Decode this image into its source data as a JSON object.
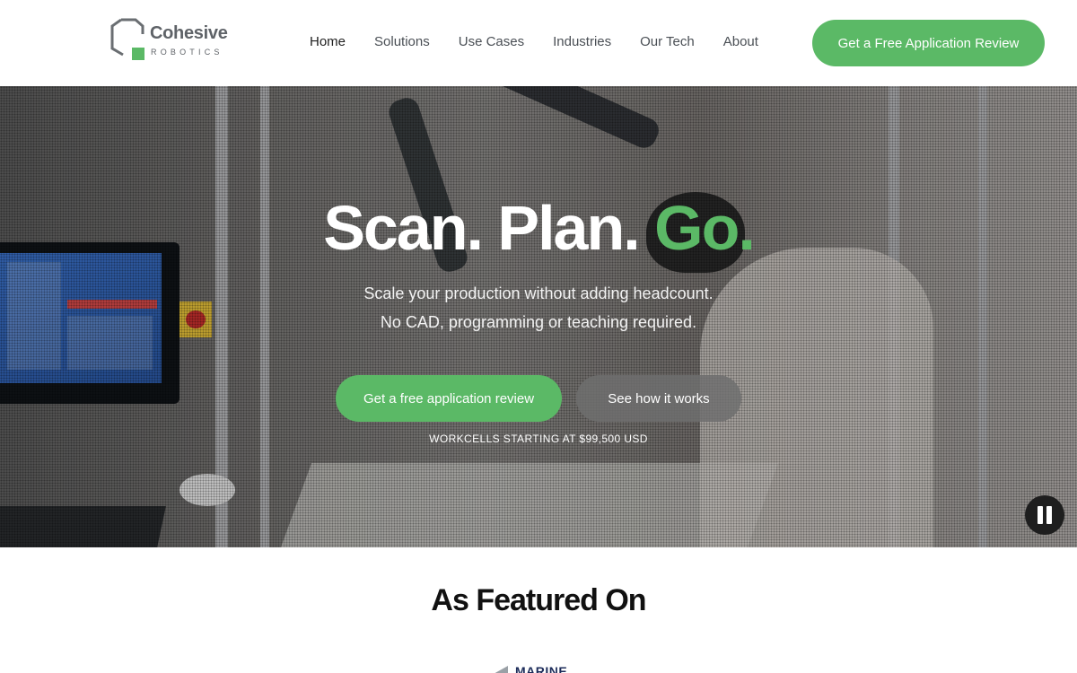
{
  "brand": {
    "name": "Cohesive",
    "tagline": "ROBOTICS",
    "colors": {
      "accent": "#5bb966",
      "logo_gray": "#5f6368"
    }
  },
  "nav": {
    "items": [
      {
        "label": "Home",
        "active": true
      },
      {
        "label": "Solutions"
      },
      {
        "label": "Use Cases"
      },
      {
        "label": "Industries"
      },
      {
        "label": "Our Tech"
      },
      {
        "label": "About"
      }
    ],
    "cta_label": "Get a Free Application Review"
  },
  "hero": {
    "title_part1": "Scan. Plan. ",
    "title_part2": "Go",
    "title_part3": ".",
    "subtitle_line1": "Scale your production without adding headcount.",
    "subtitle_line2": "No CAD, programming or teaching required.",
    "primary_button": "Get a free application review",
    "secondary_button": "See how it works",
    "price_note": "WORKCELLS STARTING AT $99,500 USD",
    "video_control": "pause-icon"
  },
  "featured": {
    "title": "As Featured On",
    "logos": [
      {
        "text": ""
      },
      {
        "text": "MARINE"
      }
    ]
  }
}
